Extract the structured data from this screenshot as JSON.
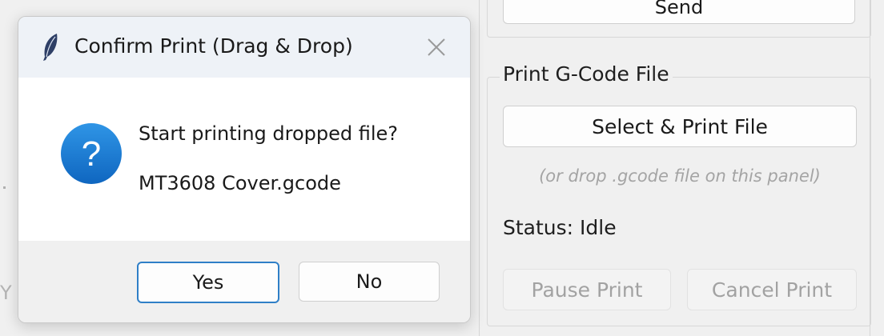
{
  "background": {
    "stray_text": "Y",
    "top_button_label": "Send",
    "print_group": {
      "title": "Print G-Code File",
      "select_button_label": "Select & Print File",
      "hint": "(or drop .gcode file on this panel)",
      "status_label": "Status:",
      "status_value": "Idle",
      "pause_button_label": "Pause Print",
      "cancel_button_label": "Cancel Print"
    }
  },
  "dialog": {
    "title": "Confirm Print (Drag & Drop)",
    "icon": "question-icon",
    "message": "Start printing dropped file?",
    "filename": "MT3608 Cover.gcode",
    "buttons": {
      "yes": "Yes",
      "no": "No"
    },
    "accent_color": "#1a78d4"
  }
}
